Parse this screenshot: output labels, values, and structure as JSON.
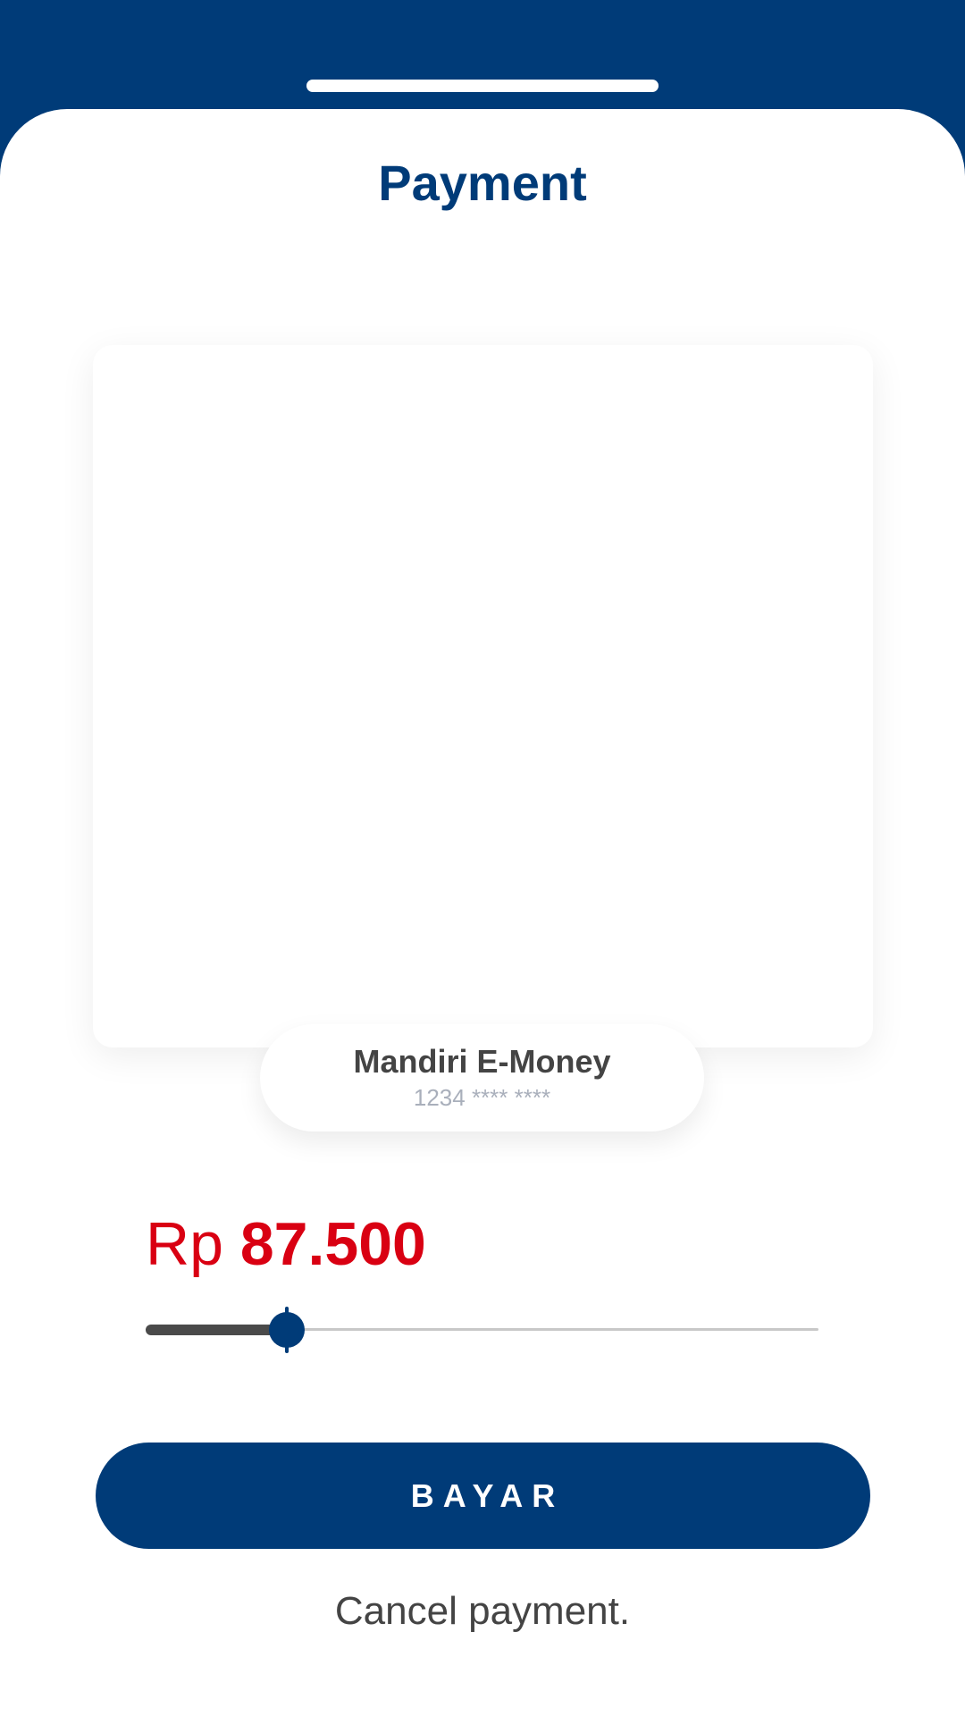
{
  "header": {
    "title": "Payment"
  },
  "card": {
    "name": "Mandiri E-Money",
    "number": "1234 **** ****"
  },
  "amount": {
    "currency": "Rp",
    "value": "87.500",
    "slider_fraction": 0.21
  },
  "actions": {
    "pay_label": "BAYAR",
    "cancel_label": "Cancel payment."
  },
  "colors": {
    "primary": "#003b78",
    "amount": "#d90012",
    "text_dark": "#444444",
    "text_muted": "#a9afbb"
  }
}
